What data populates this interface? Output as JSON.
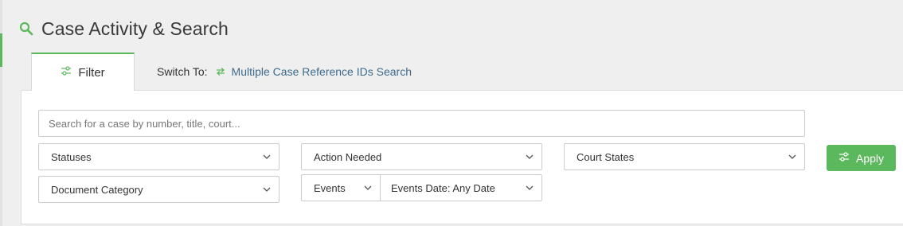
{
  "header": {
    "title": "Case Activity & Search",
    "icon": "search-icon"
  },
  "tabs": {
    "filter_label": "Filter"
  },
  "switch": {
    "label": "Switch To:",
    "link_label": "Multiple Case Reference IDs Search"
  },
  "search": {
    "placeholder": "Search for a case by number, title, court...",
    "value": ""
  },
  "filters": {
    "statuses": "Statuses",
    "action_needed": "Action Needed",
    "court_states": "Court States",
    "document_category": "Document Category",
    "events": "Events",
    "events_date": "Events Date: Any Date"
  },
  "apply": {
    "label": "Apply"
  },
  "colors": {
    "accent": "#5cb85c",
    "link": "#3d6b8c",
    "background": "#efefef"
  }
}
